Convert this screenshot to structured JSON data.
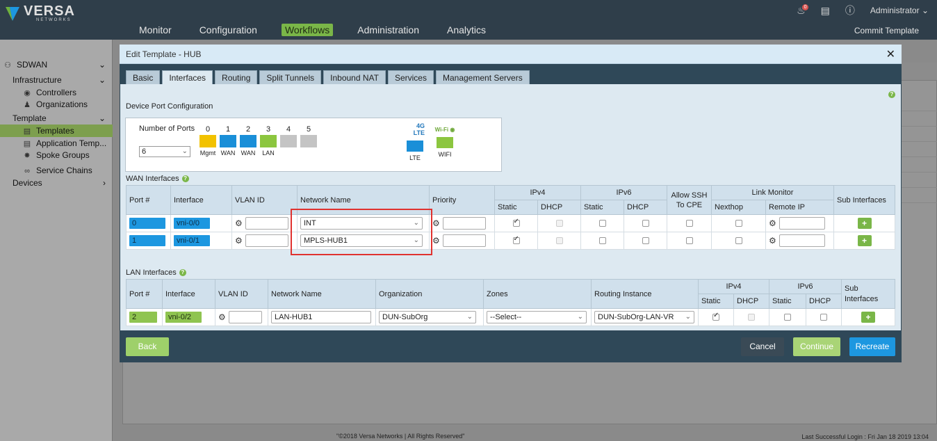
{
  "app": {
    "brand": "VERSA",
    "brand_sub": "NETWORKS",
    "admin": "Administrator",
    "notif_count": "0",
    "commit": "Commit Template"
  },
  "nav": [
    "Monitor",
    "Configuration",
    "Workflows",
    "Administration",
    "Analytics"
  ],
  "sidebar": {
    "sdwan": "SDWAN",
    "infrastructure": "Infrastructure",
    "controllers": "Controllers",
    "organizations": "Organizations",
    "template": "Template",
    "templates": "Templates",
    "application_templates": "Application Temp...",
    "spoke_groups": "Spoke Groups",
    "service_chains": "Service Chains",
    "devices": "Devices"
  },
  "modal": {
    "title": "Edit Template - HUB",
    "tabs": [
      "Basic",
      "Interfaces",
      "Routing",
      "Split Tunnels",
      "Inbound NAT",
      "Services",
      "Management Servers"
    ],
    "device_port_config": "Device Port Configuration",
    "number_of_ports_label": "Number of Ports",
    "number_of_ports": "6",
    "ports": [
      {
        "num": "0",
        "label": "Mgmt",
        "color": "#f2c200"
      },
      {
        "num": "1",
        "label": "WAN",
        "color": "#1a8fd8"
      },
      {
        "num": "2",
        "label": "WAN",
        "color": "#1a8fd8"
      },
      {
        "num": "3",
        "label": "LAN",
        "color": "#8cc63f"
      },
      {
        "num": "4",
        "label": "",
        "color": "#c4c4c4"
      },
      {
        "num": "5",
        "label": "",
        "color": "#c4c4c4"
      }
    ],
    "lte": {
      "cap": "4G LTE",
      "label": "LTE"
    },
    "wifi": {
      "cap": "Wi-Fi",
      "label": "WIFI"
    },
    "wan_title": "WAN Interfaces",
    "wan_headers": {
      "port": "Port #",
      "interface": "Interface",
      "vlan": "VLAN ID",
      "network": "Network Name",
      "priority": "Priority",
      "ipv4": "IPv4",
      "ipv6": "IPv6",
      "static": "Static",
      "dhcp": "DHCP",
      "allow_ssh": "Allow SSH To CPE",
      "link_monitor": "Link Monitor",
      "nexthop": "Nexthop",
      "remote_ip": "Remote IP",
      "sub_interfaces": "Sub Interfaces"
    },
    "wan_rows": [
      {
        "port": "0",
        "interface": "vni-0/0",
        "network": "INT"
      },
      {
        "port": "1",
        "interface": "vni-0/1",
        "network": "MPLS-HUB1"
      }
    ],
    "lan_title": "LAN Interfaces",
    "lan_headers": {
      "port": "Port #",
      "interface": "Interface",
      "vlan": "VLAN ID",
      "network": "Network Name",
      "organization": "Organization",
      "zones": "Zones",
      "routing_instance": "Routing Instance",
      "ipv4": "IPv4",
      "ipv6": "IPv6",
      "static": "Static",
      "dhcp": "DHCP",
      "sub_interfaces": "Sub Interfaces"
    },
    "lan_rows": [
      {
        "port": "2",
        "interface": "vni-0/2",
        "network": "LAN-HUB1",
        "organization": "DUN-SubOrg",
        "zones": "--Select--",
        "routing_instance": "DUN-SubOrg-LAN-VR"
      }
    ],
    "buttons": {
      "back": "Back",
      "cancel": "Cancel",
      "continue": "Continue",
      "recreate": "Recreate"
    }
  },
  "footer": {
    "copyright": "\"©2018 Versa Networks | All Rights Reserved\"",
    "last_login": "Last Successful Login : Fri Jan 18 2019 13:04"
  },
  "colors": {
    "nav_active": "#7ab648",
    "primary": "#1d97e0",
    "accent_green": "#7ab648",
    "highlight": "#e0322f"
  }
}
